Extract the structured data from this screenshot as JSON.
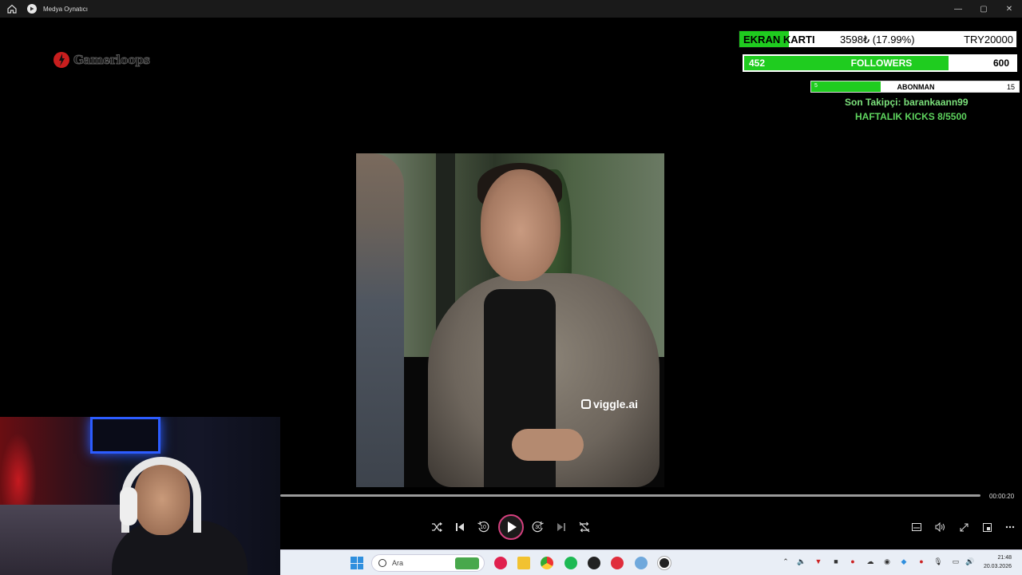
{
  "window": {
    "title": "Medya Oynatıcı",
    "minimize": "—",
    "maximize": "▢",
    "close": "✕"
  },
  "overlay": {
    "gpu_goal": {
      "label": "EKRAN KARTI",
      "value": "3598₺ (17.99%)",
      "target": "TRY20000",
      "progress": 0.1799
    },
    "followers_goal": {
      "current": "452",
      "label": "FOLLOWERS",
      "target": "600",
      "progress": 0.753
    },
    "subscriber_goal": {
      "current": "5",
      "label": "ABONMAN",
      "target": "15",
      "progress": 0.333
    },
    "last_follower": "Son Takipçi: barankaann99",
    "weekly_kicks": "HAFTALIK KICKS 8/5500"
  },
  "video": {
    "watermark": "viggle.ai"
  },
  "player": {
    "time": "00:00:20",
    "skip_back": "10",
    "skip_forward": "30"
  },
  "taskbar": {
    "search_placeholder": "Ara",
    "time": "21:48",
    "date": "20.03.2026"
  },
  "colors": {
    "goal_green": "#1fcc1f",
    "follower_text": "#7be07b",
    "play_ring": "#d4407e"
  }
}
